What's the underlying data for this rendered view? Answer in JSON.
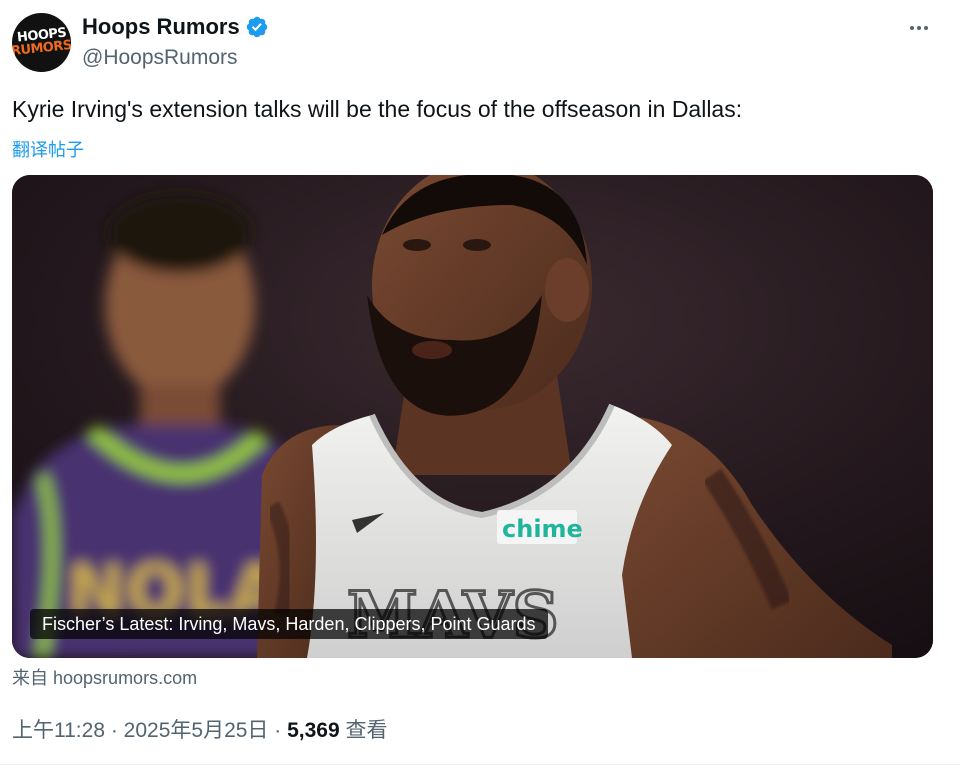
{
  "author": {
    "display_name": "Hoops Rumors",
    "handle": "@HoopsRumors",
    "avatar_text_top": "HOOPS",
    "avatar_text_bottom": "RUMORS",
    "verified_color": "#1d9bf0"
  },
  "tweet": {
    "text": "Kyrie Irving's extension talks will be the focus of the offseason in Dallas:",
    "translate_label": "翻译帖子"
  },
  "media": {
    "card_title": "Fischer’s Latest: Irving, Mavs, Harden, Clippers, Point Guards",
    "jersey_sponsor": "chime",
    "jersey_wordmark": "MAVS",
    "left_jersey_wordmark": "NOLA"
  },
  "source": {
    "prefix": "来自",
    "domain": "hoopsrumors.com"
  },
  "meta": {
    "time": "上午11:28",
    "separator1": " · ",
    "date": "2025年5月25日",
    "separator2": " · ",
    "views": "5,369",
    "views_label": "查看"
  },
  "colors": {
    "link": "#1d9bf0",
    "secondary_text": "#536471",
    "primary_text": "#0f1419"
  }
}
